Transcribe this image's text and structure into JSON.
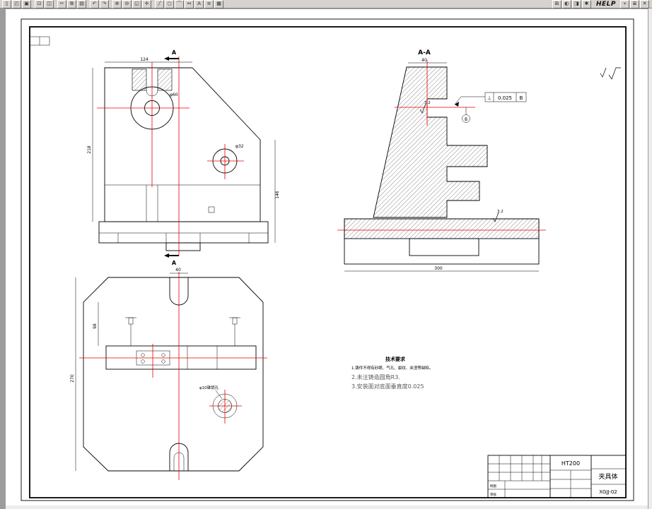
{
  "colors": {
    "desktop": "#9c9c9c",
    "sheet": "#ffffff",
    "line": "#000000",
    "centerline": "#e60000",
    "toolbar_bg": "#d6d3ce"
  },
  "toolbar": {
    "help_label": "HELP",
    "groups": {
      "left": [
        {
          "n": "new",
          "g": "▯"
        },
        {
          "n": "open",
          "g": "◰"
        },
        {
          "n": "save",
          "g": "▣"
        },
        {
          "n": "sep",
          "g": ""
        },
        {
          "n": "print",
          "g": "⊡"
        },
        {
          "n": "preview",
          "g": "◫"
        },
        {
          "n": "sep",
          "g": ""
        },
        {
          "n": "cut",
          "g": "✂"
        },
        {
          "n": "copy",
          "g": "⧉"
        },
        {
          "n": "paste",
          "g": "▤"
        },
        {
          "n": "sep",
          "g": ""
        },
        {
          "n": "undo",
          "g": "↶"
        },
        {
          "n": "redo",
          "g": "↷"
        },
        {
          "n": "sep",
          "g": ""
        },
        {
          "n": "zoom-in",
          "g": "⊕"
        },
        {
          "n": "zoom-out",
          "g": "⊖"
        },
        {
          "n": "zoom-window",
          "g": "◱"
        },
        {
          "n": "pan",
          "g": "✛"
        },
        {
          "n": "sep",
          "g": ""
        },
        {
          "n": "line",
          "g": "╱"
        },
        {
          "n": "circle",
          "g": "○"
        },
        {
          "n": "arc",
          "g": "⌒"
        },
        {
          "n": "dimension",
          "g": "↔"
        },
        {
          "n": "text",
          "g": "A"
        },
        {
          "n": "layers",
          "g": "≡"
        },
        {
          "n": "grid",
          "g": "▦"
        }
      ],
      "mid": [
        {
          "n": "plot",
          "g": "⊞"
        },
        {
          "n": "render",
          "g": "◐"
        },
        {
          "n": "views",
          "g": "◨"
        },
        {
          "n": "options",
          "g": "✱"
        }
      ],
      "right": [
        {
          "n": "object-snap",
          "g": "⌖"
        },
        {
          "n": "properties",
          "g": "≣"
        },
        {
          "n": "close",
          "g": "✕"
        }
      ]
    }
  },
  "front_view": {
    "section_arrow_top": "A",
    "section_arrow_bottom": "A",
    "dims": {
      "top": "124",
      "left": "218",
      "right": "146",
      "bore_large": "φ60",
      "bore_small": "φ32"
    }
  },
  "section_view": {
    "label": "A-A",
    "dims": {
      "top": "40",
      "base": "300"
    },
    "finish_top": "3.2",
    "finish_base": "3.2",
    "tolerance": {
      "symbol": "⊥",
      "value": "0.025",
      "datum": "B"
    },
    "datum_circle": "B"
  },
  "top_view": {
    "dims": {
      "slot": "40",
      "height": "270",
      "step": "98"
    },
    "hole_label": "φ10锥销孔"
  },
  "tech_requirements": {
    "title": "技术要求",
    "line1": "1.铸件不得有砂眼、气孔、裂纹、夹渣等缺陷。",
    "line2": "2.未注铸造圆角R3.",
    "line3": "3.安装面对底面垂直度0.025"
  },
  "title_block": {
    "material": "HT200",
    "part_name": "夹具体",
    "drawing_no": "XGJJ-02",
    "label_draw": "制图",
    "label_check": "审核"
  }
}
